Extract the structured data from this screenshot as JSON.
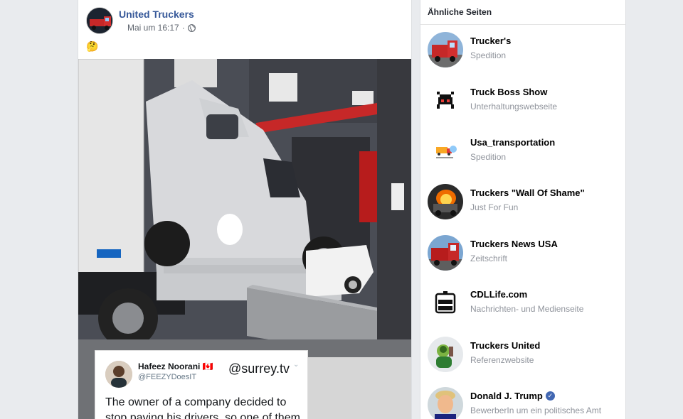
{
  "post": {
    "page_name": "United Truckers",
    "timestamp": "Mai um 16:17",
    "separator": "·",
    "emoji": "🤔",
    "image": {
      "tweet": {
        "author_name": "Hafeez Noorani",
        "author_flag": "🇨🇦",
        "handle": "@FEEZYDoesIT",
        "source_watermark": "@surrey.tv",
        "caret": "⌄",
        "text": "The owner of a company decided to stop paying his drivers, so one of them"
      }
    }
  },
  "sidebar": {
    "title": "Ähnliche Seiten",
    "items": [
      {
        "name": "Trucker's",
        "category": "Spedition",
        "icon": "red-truck-icon",
        "verified": false
      },
      {
        "name": "Truck Boss Show",
        "category": "Unterhaltungswebseite",
        "icon": "truck-boss-logo-icon",
        "verified": false
      },
      {
        "name": "Usa_transportation",
        "category": "Spedition",
        "icon": "transport-logo-icon",
        "verified": false
      },
      {
        "name": "Truckers \"Wall Of Shame\"",
        "category": "Just For Fun",
        "icon": "burning-truck-icon",
        "verified": false
      },
      {
        "name": "Truckers News USA",
        "category": "Zeitschrift",
        "icon": "red-truck-icon",
        "verified": false
      },
      {
        "name": "CDLLife.com",
        "category": "Nachrichten- und Medienseite",
        "icon": "cdl-life-logo-icon",
        "verified": false
      },
      {
        "name": "Truckers United",
        "category": "Referenzwebsite",
        "icon": "cartoon-trucker-icon",
        "verified": false
      },
      {
        "name": "Donald J. Trump",
        "category": "BewerberIn um ein politisches Amt",
        "icon": "portrait-icon",
        "verified": true,
        "verified_mark": "✓"
      }
    ]
  },
  "colors": {
    "link_blue": "#365899",
    "secondary_text": "#90949c",
    "background": "#e9ebee",
    "verified_blue": "#4267b2"
  }
}
